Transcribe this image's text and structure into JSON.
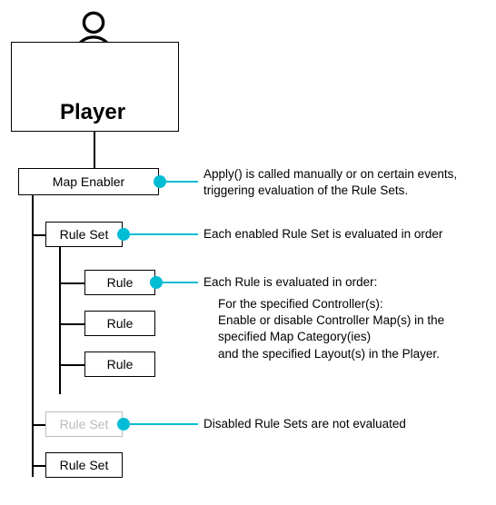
{
  "player": {
    "label": "Player"
  },
  "map_enabler": {
    "label": "Map Enabler",
    "desc": "Apply() is called manually or on certain events, triggering evaluation of the Rule Sets."
  },
  "rule_set_1": {
    "label": "Rule Set",
    "desc": "Each enabled Rule Set is evaluated in order"
  },
  "rules": {
    "r1": {
      "label": "Rule"
    },
    "r2": {
      "label": "Rule"
    },
    "r3": {
      "label": "Rule"
    },
    "desc_heading": "Each Rule is evaluated in order:",
    "desc_body": "For the specified Controller(s):\nEnable or disable Controller Map(s) in the specified Map Category(ies)\nand the specified Layout(s) in the Player."
  },
  "rule_set_disabled": {
    "label": "Rule Set",
    "desc": "Disabled Rule Sets are not evaluated"
  },
  "rule_set_3": {
    "label": "Rule Set"
  }
}
